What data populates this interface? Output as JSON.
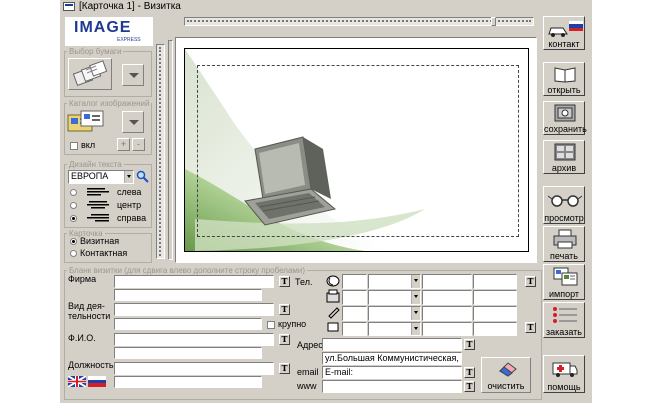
{
  "window": {
    "title": "[Карточка 1] - Визитка"
  },
  "logo": {
    "brand": "IMAGE",
    "sub": "EXPRESS"
  },
  "paper": {
    "group_label": "Выбор бумаги"
  },
  "catalog": {
    "group_label": "Каталог изображений",
    "checkbox_label": "вкл",
    "plus": "+",
    "minus": "-"
  },
  "text_design": {
    "group_label": "Дизайн текста",
    "font_value": "ЕВРОПА",
    "align_left": "слева",
    "align_center": "центр",
    "align_right": "справа",
    "selected": "справа"
  },
  "card": {
    "group_label": "Карточка",
    "opt1": "Визитная",
    "opt2": "Контактная",
    "selected": "Визитная"
  },
  "form": {
    "group_label": "Бланк визитки (для сдвига влево дополните строку пробелами)",
    "firm_label": "Фирма",
    "activity_label_1": "Вид дея-",
    "activity_label_2": "тельности",
    "large_label": "крупно",
    "fio_label": "Ф.И.О.",
    "position_label": "Должность",
    "tel_label": "Тел.",
    "address_label": "Адрес",
    "email_label": "email",
    "www_label": "www",
    "address_value": "ул.Большая Коммунистическая,",
    "email_value": "E-mail:",
    "t_glyph": "T"
  },
  "sidebar": {
    "contact": "контакт",
    "open": "открыть",
    "save": "сохранить",
    "archive": "архив",
    "preview": "просмотр",
    "print": "печать",
    "import": "импорт",
    "order": "заказать",
    "help": "помощь",
    "clear": "очистить"
  },
  "colors": {
    "window_bg": "#d4d0c8",
    "flag_blue": "#1f3fa8",
    "flag_red": "#d41f26",
    "logo_blue": "#1f3a93"
  }
}
